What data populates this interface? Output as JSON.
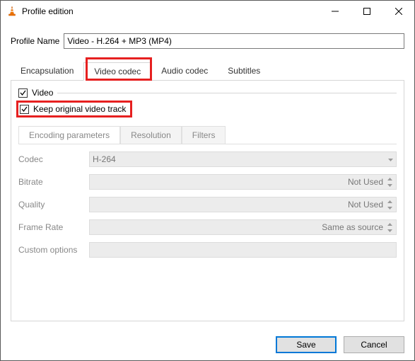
{
  "window": {
    "title": "Profile edition"
  },
  "profile": {
    "label": "Profile Name",
    "value": "Video - H.264 + MP3 (MP4)"
  },
  "tabs": {
    "encapsulation": "Encapsulation",
    "video_codec": "Video codec",
    "audio_codec": "Audio codec",
    "subtitles": "Subtitles"
  },
  "video_tab": {
    "video_checkbox": "Video",
    "keep_original": "Keep original video track",
    "subtabs": {
      "encoding": "Encoding parameters",
      "resolution": "Resolution",
      "filters": "Filters"
    },
    "params": {
      "codec_label": "Codec",
      "codec_value": "H-264",
      "bitrate_label": "Bitrate",
      "bitrate_value": "Not Used",
      "quality_label": "Quality",
      "quality_value": "Not Used",
      "framerate_label": "Frame Rate",
      "framerate_value": "Same as source",
      "custom_label": "Custom options"
    }
  },
  "buttons": {
    "save": "Save",
    "cancel": "Cancel"
  }
}
